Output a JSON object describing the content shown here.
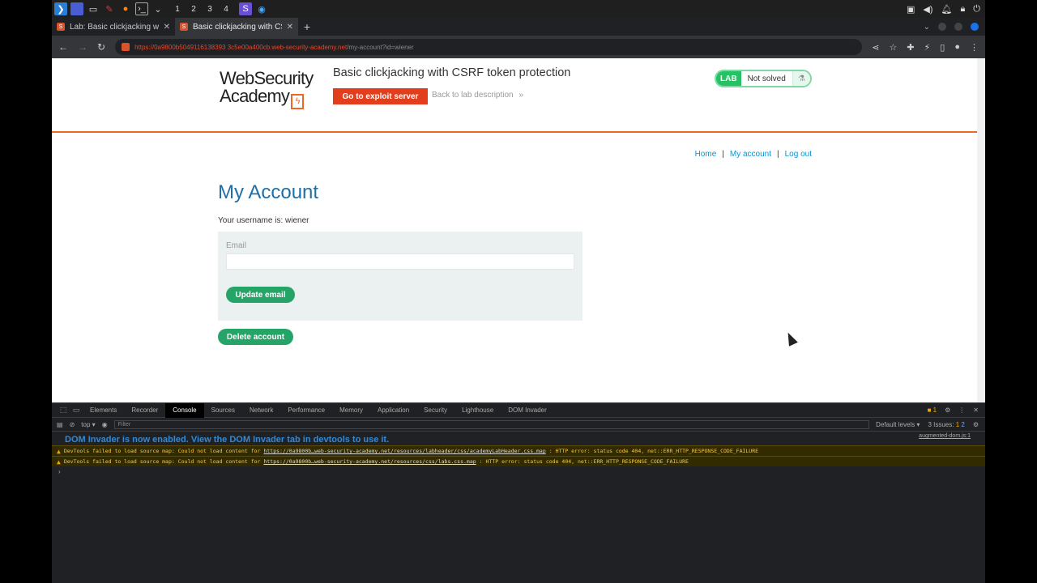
{
  "taskbar": {
    "workspaces": [
      "1",
      "2",
      "3",
      "4"
    ]
  },
  "browser": {
    "tabs": [
      {
        "label": "Lab: Basic clickjacking wit",
        "close": "✕"
      },
      {
        "label": "Basic clickjacking with CSR",
        "close": "✕"
      }
    ],
    "new_tab": "+",
    "url_host": "https://0a9800b5049116138393 3c5e00a400cb.web-security-academy.net",
    "url_path": "/my-account?id=wiener"
  },
  "page": {
    "logo_line1": "WebSecurity",
    "logo_line2": "Academy",
    "lab_title": "Basic clickjacking with CSRF token protection",
    "exploit_button": "Go to exploit server",
    "back_link": "Back to lab description",
    "back_arrows": "»",
    "lab_badge": "LAB",
    "lab_status": "Not solved",
    "nav": {
      "home": "Home",
      "sep": "|",
      "my_account": "My account",
      "logout": "Log out"
    },
    "heading": "My Account",
    "username_text": "Your username is: wiener",
    "email_label": "Email",
    "email_value": "",
    "update_button": "Update email",
    "delete_button": "Delete account"
  },
  "devtools": {
    "tabs": [
      "Elements",
      "Recorder",
      "Console",
      "Sources",
      "Network",
      "Performance",
      "Memory",
      "Application",
      "Security",
      "Lighthouse",
      "DOM Invader"
    ],
    "issue_badge": "1",
    "context": "top ▾",
    "filter_placeholder": "Filter",
    "levels": "Default levels ▾",
    "issues": "3 Issues:",
    "issues_warn": "1",
    "issues_info": "2",
    "source_ref": "augmented-dom.js:1",
    "dom_invader_msg": "DOM Invader is now enabled. View the DOM Invader tab in devtools to use it.",
    "warnings": [
      {
        "prefix": "DevTools failed to load source map: Could not load content for",
        "link": "https://0a9800b…web-security-academy.net/resources/labheader/css/academyLabHeader.css.map",
        "suffix": ": HTTP error: status code 404, net::ERR_HTTP_RESPONSE_CODE_FAILURE"
      },
      {
        "prefix": "DevTools failed to load source map: Could not load content for",
        "link": "https://0a9800b…web-security-academy.net/resources/css/labs.css.map",
        "suffix": ": HTTP error: status code 404, net::ERR_HTTP_RESPONSE_CODE_FAILURE"
      }
    ],
    "prompt": "›"
  }
}
